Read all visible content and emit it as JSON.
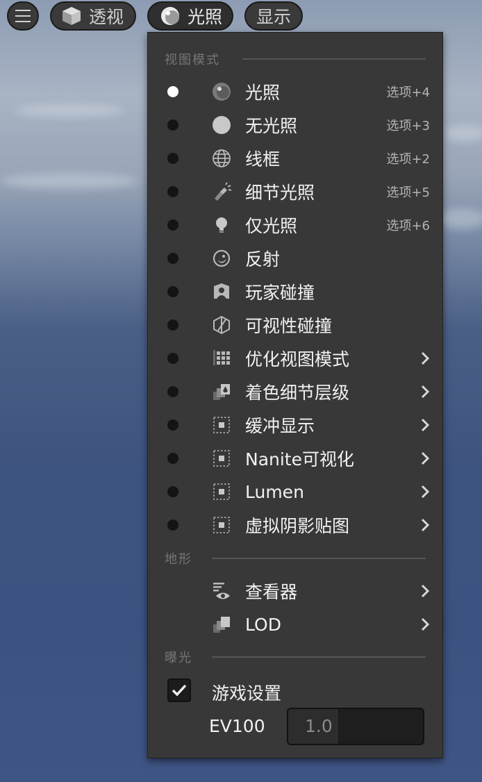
{
  "toolbar": {
    "perspective_label": "透视",
    "lighting_label": "光照",
    "show_label": "显示"
  },
  "menu": {
    "section_view_mode": "视图模式",
    "view_modes": [
      {
        "label": "光照",
        "shortcut": "选项+4",
        "icon": "lit-sphere-icon",
        "selected": true
      },
      {
        "label": "无光照",
        "shortcut": "选项+3",
        "icon": "unlit-sphere-icon",
        "selected": false
      },
      {
        "label": "线框",
        "shortcut": "选项+2",
        "icon": "wireframe-globe-icon",
        "selected": false
      },
      {
        "label": "细节光照",
        "shortcut": "选项+5",
        "icon": "detail-lighting-icon",
        "selected": false
      },
      {
        "label": "仅光照",
        "shortcut": "选项+6",
        "icon": "lightbulb-icon",
        "selected": false
      },
      {
        "label": "反射",
        "shortcut": "",
        "icon": "reflection-icon",
        "selected": false
      },
      {
        "label": "玩家碰撞",
        "shortcut": "",
        "icon": "player-collision-icon",
        "selected": false
      },
      {
        "label": "可视性碰撞",
        "shortcut": "",
        "icon": "visibility-collision-icon",
        "selected": false
      },
      {
        "label": "优化视图模式",
        "shortcut": "",
        "icon": "optimization-grid-icon",
        "selected": false,
        "submenu": true
      },
      {
        "label": "着色细节层级",
        "shortcut": "",
        "icon": "shading-lod-icon",
        "selected": false,
        "submenu": true
      },
      {
        "label": "缓冲显示",
        "shortcut": "",
        "icon": "buffer-visualization-icon",
        "selected": false,
        "submenu": true
      },
      {
        "label": "Nanite可视化",
        "shortcut": "",
        "icon": "nanite-visualization-icon",
        "selected": false,
        "submenu": true
      },
      {
        "label": "Lumen",
        "shortcut": "",
        "icon": "lumen-visualization-icon",
        "selected": false,
        "submenu": true
      },
      {
        "label": "虚拟阴影贴图",
        "shortcut": "",
        "icon": "virtual-shadow-map-icon",
        "selected": false,
        "submenu": true
      }
    ],
    "section_landscape": "地形",
    "landscape_items": [
      {
        "label": "查看器",
        "icon": "viewer-eye-icon",
        "submenu": true
      },
      {
        "label": "LOD",
        "icon": "lod-icon",
        "submenu": true
      }
    ],
    "section_exposure": "曝光",
    "game_settings_label": "游戏设置",
    "game_settings_checked": true,
    "ev100_label": "EV100",
    "ev100_value": "1.0"
  },
  "colors": {
    "panel_bg": "#383838",
    "selected_radio": "#ffffff",
    "unselected_radio": "#141414",
    "text": "#f2f2f2"
  }
}
